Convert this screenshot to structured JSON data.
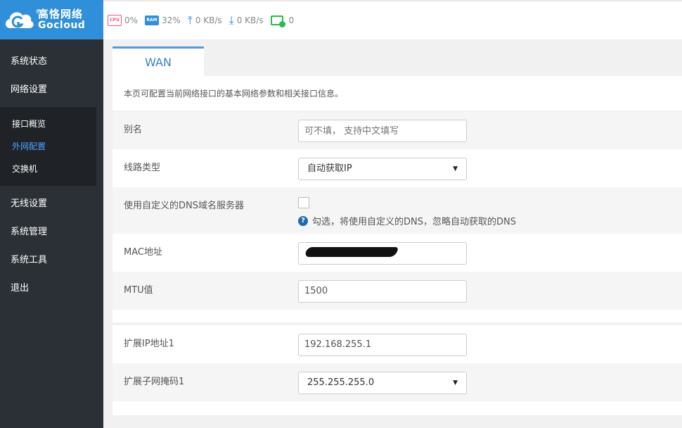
{
  "brand": {
    "name_cn": "高恪网络",
    "name_en": "Gocloud",
    "reg": "®"
  },
  "status": {
    "cpu_label": "CPU",
    "cpu_value": "0%",
    "ram_label": "RAM",
    "ram_value": "32%",
    "upload": "0 KB/s",
    "download": "0 KB/s",
    "clients": "0"
  },
  "sidebar": {
    "items": [
      {
        "label": "系统状态"
      },
      {
        "label": "网络设置"
      },
      {
        "label": "无线设置"
      },
      {
        "label": "系统管理"
      },
      {
        "label": "系统工具"
      },
      {
        "label": "退出"
      }
    ],
    "sub_items": [
      {
        "label": "接口概览"
      },
      {
        "label": "外网配置"
      },
      {
        "label": "交换机"
      }
    ]
  },
  "tab": {
    "label": "WAN"
  },
  "description": "本页可配置当前网络接口的基本网络参数和相关接口信息。",
  "form": {
    "alias_label": "别名",
    "alias_placeholder": "可不填， 支持中文填写",
    "line_type_label": "线路类型",
    "line_type_value": "自动获取IP",
    "custom_dns_label": "使用自定义的DNS域名服务器",
    "custom_dns_hint": "勾选，将使用自定义的DNS，忽略自动获取的DNS",
    "mac_label": "MAC地址",
    "mtu_label": "MTU值",
    "mtu_value": "1500",
    "ext_ip_label": "扩展IP地址1",
    "ext_ip_value": "192.168.255.1",
    "ext_mask_label": "扩展子网掩码1",
    "ext_mask_value": "255.255.255.0"
  },
  "colors": {
    "accent": "#2f8fd8",
    "sidebar": "#2b3036",
    "active_sub": "#4fa3ff"
  }
}
